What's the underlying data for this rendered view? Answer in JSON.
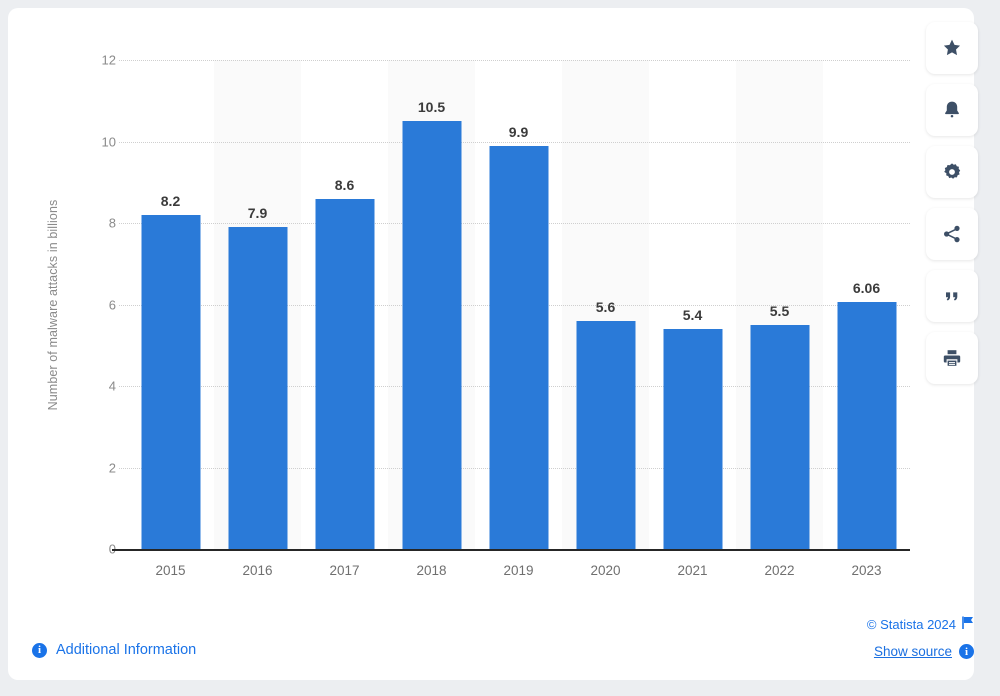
{
  "chart_data": {
    "type": "bar",
    "title": "",
    "xlabel": "",
    "ylabel": "Number of malware attacks in billions",
    "categories": [
      "2015",
      "2016",
      "2017",
      "2018",
      "2019",
      "2020",
      "2021",
      "2022",
      "2023"
    ],
    "values": [
      8.2,
      7.9,
      8.6,
      10.5,
      9.9,
      5.6,
      5.4,
      5.5,
      6.06
    ],
    "value_labels": [
      "8.2",
      "7.9",
      "8.6",
      "10.5",
      "9.9",
      "5.6",
      "5.4",
      "5.5",
      "6.06"
    ],
    "ylim": [
      0,
      12
    ],
    "yticks": [
      0,
      2,
      4,
      6,
      8,
      10,
      12
    ],
    "ytick_labels": [
      "0",
      "2",
      "4",
      "6",
      "8",
      "10",
      "12"
    ],
    "grid": true,
    "legend": false,
    "bar_color": "#2a7ad8",
    "label_color": "#3b3b3b"
  },
  "toolbar": {
    "buttons": [
      {
        "name": "favorite-button",
        "icon": "star-icon"
      },
      {
        "name": "notification-button",
        "icon": "bell-icon"
      },
      {
        "name": "settings-button",
        "icon": "gear-icon"
      },
      {
        "name": "share-button",
        "icon": "share-icon"
      },
      {
        "name": "cite-button",
        "icon": "quote-icon"
      },
      {
        "name": "print-button",
        "icon": "print-icon"
      }
    ]
  },
  "footer": {
    "copyright": "© Statista 2024",
    "flag_icon": "flag-icon",
    "show_source": "Show source",
    "show_source_icon": "info-icon",
    "additional_information": "Additional Information",
    "additional_information_icon": "info-icon",
    "link_color": "#1a73e8"
  }
}
